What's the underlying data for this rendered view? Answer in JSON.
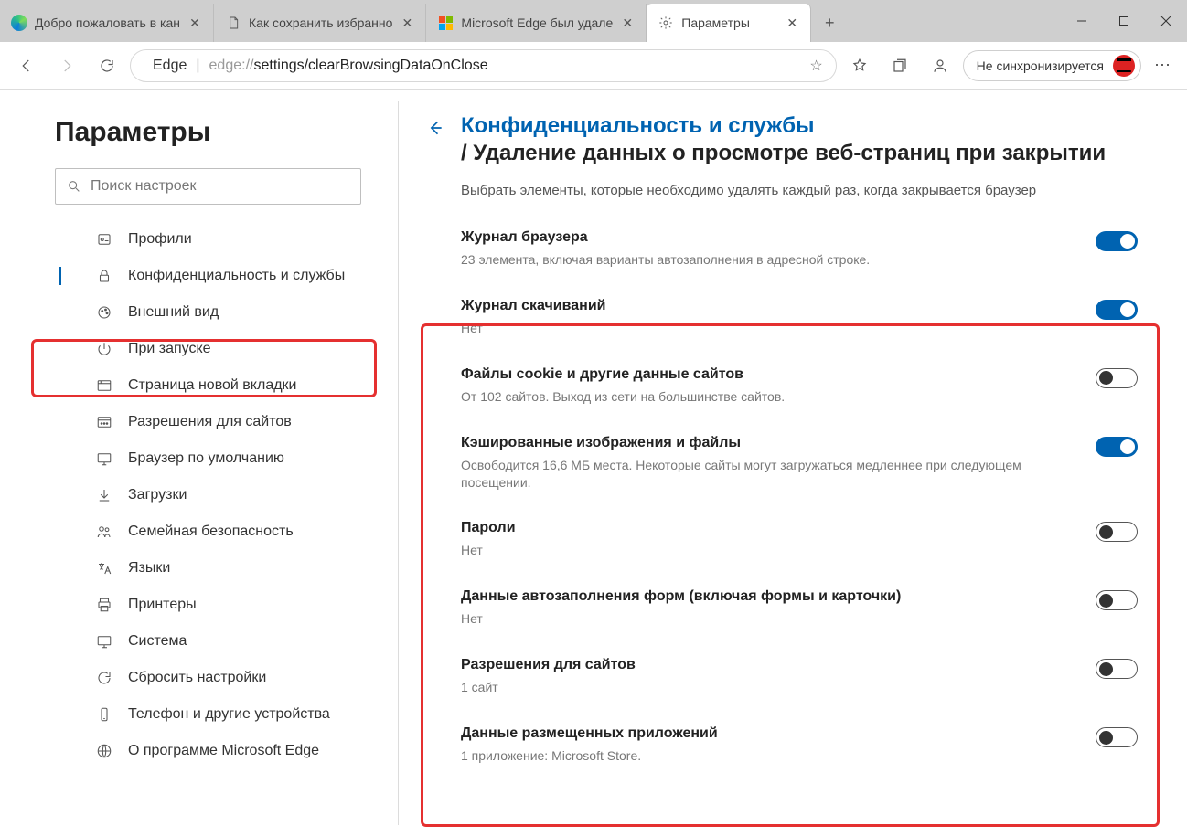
{
  "window": {
    "minimize": "—",
    "maximize": "☐",
    "close": "✕"
  },
  "tabs": [
    {
      "title": "Добро пожаловать в кан",
      "icon": "edge"
    },
    {
      "title": "Как сохранить избранно",
      "icon": "file"
    },
    {
      "title": "Microsoft Edge был удале",
      "icon": "ms"
    },
    {
      "title": "Параметры",
      "icon": "gear",
      "active": true
    }
  ],
  "toolbar": {
    "page_label": "Edge",
    "url_prefix": "edge://",
    "url_path": "settings/clearBrowsingDataOnClose",
    "sync_label": "Не синхронизируется"
  },
  "sidebar": {
    "heading": "Параметры",
    "search_placeholder": "Поиск настроек",
    "items": [
      {
        "label": "Профили",
        "icon": "profile"
      },
      {
        "label": "Конфиденциальность и службы",
        "icon": "lock",
        "active": true
      },
      {
        "label": "Внешний вид",
        "icon": "appearance"
      },
      {
        "label": "При запуске",
        "icon": "power"
      },
      {
        "label": "Страница новой вкладки",
        "icon": "newtab"
      },
      {
        "label": "Разрешения для сайтов",
        "icon": "permissions"
      },
      {
        "label": "Браузер по умолчанию",
        "icon": "default"
      },
      {
        "label": "Загрузки",
        "icon": "download"
      },
      {
        "label": "Семейная безопасность",
        "icon": "family"
      },
      {
        "label": "Языки",
        "icon": "lang"
      },
      {
        "label": "Принтеры",
        "icon": "printer"
      },
      {
        "label": "Система",
        "icon": "system"
      },
      {
        "label": "Сбросить настройки",
        "icon": "reset"
      },
      {
        "label": "Телефон и другие устройства",
        "icon": "phone"
      },
      {
        "label": "О программе Microsoft Edge",
        "icon": "about"
      }
    ]
  },
  "main": {
    "bc1": "Конфиденциальность и службы",
    "bc2": "/ Удаление данных о просмотре веб-страниц при закрытии",
    "subhead": "Выбрать элементы, которые необходимо удалять каждый раз, когда закрывается браузер",
    "rows": [
      {
        "title": "Журнал браузера",
        "desc": "23 элемента, включая варианты автозаполнения в адресной строке.",
        "on": true
      },
      {
        "title": "Журнал скачиваний",
        "desc": "Нет",
        "on": true
      },
      {
        "title": "Файлы cookie и другие данные сайтов",
        "desc": "От 102 сайтов. Выход из сети на большинстве сайтов.",
        "on": false
      },
      {
        "title": "Кэшированные изображения и файлы",
        "desc": "Освободится 16,6 МБ места. Некоторые сайты могут загружаться медленнее при следующем посещении.",
        "on": true
      },
      {
        "title": "Пароли",
        "desc": "Нет",
        "on": false
      },
      {
        "title": "Данные автозаполнения форм (включая формы и карточки)",
        "desc": "Нет",
        "on": false
      },
      {
        "title": "Разрешения для сайтов",
        "desc": "1 сайт",
        "on": false
      },
      {
        "title": "Данные размещенных приложений",
        "desc": "1 приложение: Microsoft Store.",
        "on": false
      }
    ]
  }
}
